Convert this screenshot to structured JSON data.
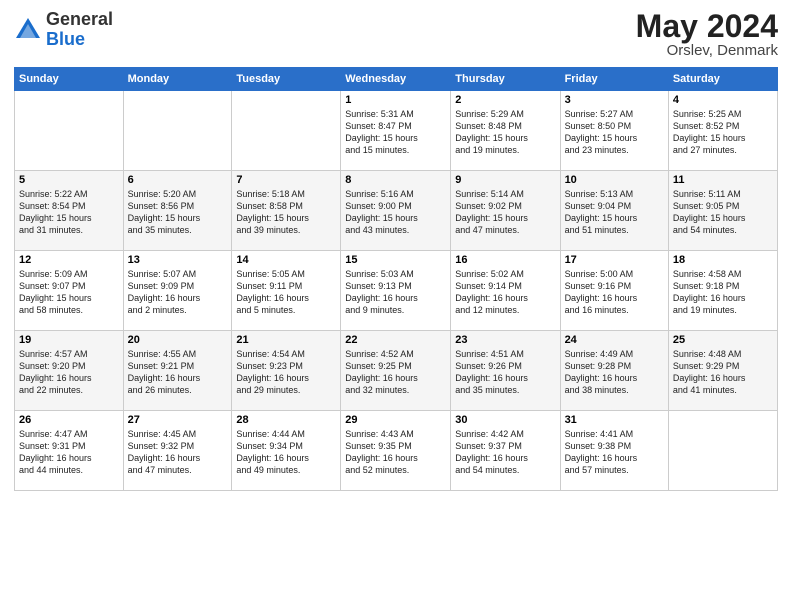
{
  "header": {
    "logo": {
      "general": "General",
      "blue": "Blue"
    },
    "title": "May 2024",
    "location": "Orslev, Denmark"
  },
  "calendar": {
    "days_of_week": [
      "Sunday",
      "Monday",
      "Tuesday",
      "Wednesday",
      "Thursday",
      "Friday",
      "Saturday"
    ],
    "weeks": [
      [
        {
          "day": "",
          "info": ""
        },
        {
          "day": "",
          "info": ""
        },
        {
          "day": "",
          "info": ""
        },
        {
          "day": "1",
          "info": "Sunrise: 5:31 AM\nSunset: 8:47 PM\nDaylight: 15 hours\nand 15 minutes."
        },
        {
          "day": "2",
          "info": "Sunrise: 5:29 AM\nSunset: 8:48 PM\nDaylight: 15 hours\nand 19 minutes."
        },
        {
          "day": "3",
          "info": "Sunrise: 5:27 AM\nSunset: 8:50 PM\nDaylight: 15 hours\nand 23 minutes."
        },
        {
          "day": "4",
          "info": "Sunrise: 5:25 AM\nSunset: 8:52 PM\nDaylight: 15 hours\nand 27 minutes."
        }
      ],
      [
        {
          "day": "5",
          "info": "Sunrise: 5:22 AM\nSunset: 8:54 PM\nDaylight: 15 hours\nand 31 minutes."
        },
        {
          "day": "6",
          "info": "Sunrise: 5:20 AM\nSunset: 8:56 PM\nDaylight: 15 hours\nand 35 minutes."
        },
        {
          "day": "7",
          "info": "Sunrise: 5:18 AM\nSunset: 8:58 PM\nDaylight: 15 hours\nand 39 minutes."
        },
        {
          "day": "8",
          "info": "Sunrise: 5:16 AM\nSunset: 9:00 PM\nDaylight: 15 hours\nand 43 minutes."
        },
        {
          "day": "9",
          "info": "Sunrise: 5:14 AM\nSunset: 9:02 PM\nDaylight: 15 hours\nand 47 minutes."
        },
        {
          "day": "10",
          "info": "Sunrise: 5:13 AM\nSunset: 9:04 PM\nDaylight: 15 hours\nand 51 minutes."
        },
        {
          "day": "11",
          "info": "Sunrise: 5:11 AM\nSunset: 9:05 PM\nDaylight: 15 hours\nand 54 minutes."
        }
      ],
      [
        {
          "day": "12",
          "info": "Sunrise: 5:09 AM\nSunset: 9:07 PM\nDaylight: 15 hours\nand 58 minutes."
        },
        {
          "day": "13",
          "info": "Sunrise: 5:07 AM\nSunset: 9:09 PM\nDaylight: 16 hours\nand 2 minutes."
        },
        {
          "day": "14",
          "info": "Sunrise: 5:05 AM\nSunset: 9:11 PM\nDaylight: 16 hours\nand 5 minutes."
        },
        {
          "day": "15",
          "info": "Sunrise: 5:03 AM\nSunset: 9:13 PM\nDaylight: 16 hours\nand 9 minutes."
        },
        {
          "day": "16",
          "info": "Sunrise: 5:02 AM\nSunset: 9:14 PM\nDaylight: 16 hours\nand 12 minutes."
        },
        {
          "day": "17",
          "info": "Sunrise: 5:00 AM\nSunset: 9:16 PM\nDaylight: 16 hours\nand 16 minutes."
        },
        {
          "day": "18",
          "info": "Sunrise: 4:58 AM\nSunset: 9:18 PM\nDaylight: 16 hours\nand 19 minutes."
        }
      ],
      [
        {
          "day": "19",
          "info": "Sunrise: 4:57 AM\nSunset: 9:20 PM\nDaylight: 16 hours\nand 22 minutes."
        },
        {
          "day": "20",
          "info": "Sunrise: 4:55 AM\nSunset: 9:21 PM\nDaylight: 16 hours\nand 26 minutes."
        },
        {
          "day": "21",
          "info": "Sunrise: 4:54 AM\nSunset: 9:23 PM\nDaylight: 16 hours\nand 29 minutes."
        },
        {
          "day": "22",
          "info": "Sunrise: 4:52 AM\nSunset: 9:25 PM\nDaylight: 16 hours\nand 32 minutes."
        },
        {
          "day": "23",
          "info": "Sunrise: 4:51 AM\nSunset: 9:26 PM\nDaylight: 16 hours\nand 35 minutes."
        },
        {
          "day": "24",
          "info": "Sunrise: 4:49 AM\nSunset: 9:28 PM\nDaylight: 16 hours\nand 38 minutes."
        },
        {
          "day": "25",
          "info": "Sunrise: 4:48 AM\nSunset: 9:29 PM\nDaylight: 16 hours\nand 41 minutes."
        }
      ],
      [
        {
          "day": "26",
          "info": "Sunrise: 4:47 AM\nSunset: 9:31 PM\nDaylight: 16 hours\nand 44 minutes."
        },
        {
          "day": "27",
          "info": "Sunrise: 4:45 AM\nSunset: 9:32 PM\nDaylight: 16 hours\nand 47 minutes."
        },
        {
          "day": "28",
          "info": "Sunrise: 4:44 AM\nSunset: 9:34 PM\nDaylight: 16 hours\nand 49 minutes."
        },
        {
          "day": "29",
          "info": "Sunrise: 4:43 AM\nSunset: 9:35 PM\nDaylight: 16 hours\nand 52 minutes."
        },
        {
          "day": "30",
          "info": "Sunrise: 4:42 AM\nSunset: 9:37 PM\nDaylight: 16 hours\nand 54 minutes."
        },
        {
          "day": "31",
          "info": "Sunrise: 4:41 AM\nSunset: 9:38 PM\nDaylight: 16 hours\nand 57 minutes."
        },
        {
          "day": "",
          "info": ""
        }
      ]
    ]
  }
}
